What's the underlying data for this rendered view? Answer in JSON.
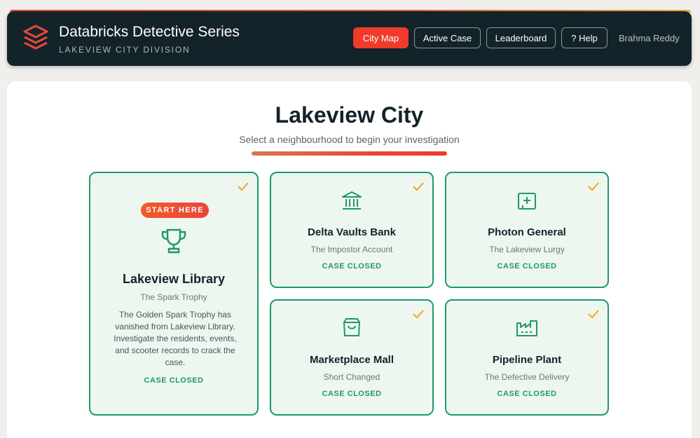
{
  "header": {
    "title": "Databricks Detective Series",
    "subtitle": "LAKEVIEW CITY DIVISION",
    "nav": {
      "city_map": "City Map",
      "active_case": "Active Case",
      "leaderboard": "Leaderboard",
      "help": "? Help"
    },
    "user": "Brahma Reddy"
  },
  "main": {
    "title": "Lakeview City",
    "subtitle": "Select a neighbourhood to begin your investigation",
    "cards": [
      {
        "name": "Lakeview Library",
        "case": "The Spark Trophy",
        "badge": "START HERE",
        "description": "The Golden Spark Trophy has vanished from Lakeview Library. Investigate the residents, events, and scooter records to crack the case.",
        "status": "CASE CLOSED",
        "icon": "trophy-icon"
      },
      {
        "name": "Delta Vaults Bank",
        "case": "The Impostor Account",
        "status": "CASE CLOSED",
        "icon": "bank-icon"
      },
      {
        "name": "Photon General",
        "case": "The Lakeview Lurgy",
        "status": "CASE CLOSED",
        "icon": "hospital-icon"
      },
      {
        "name": "Marketplace Mall",
        "case": "Short Changed",
        "status": "CASE CLOSED",
        "icon": "shopping-bag-icon"
      },
      {
        "name": "Pipeline Plant",
        "case": "The Defective Delivery",
        "status": "CASE CLOSED",
        "icon": "factory-icon"
      }
    ]
  },
  "colors": {
    "accent": "#f03b2a",
    "header_bg": "#13232a",
    "card_border": "#1f9a63",
    "card_bg": "#eef6f0",
    "check": "#f0a623"
  }
}
